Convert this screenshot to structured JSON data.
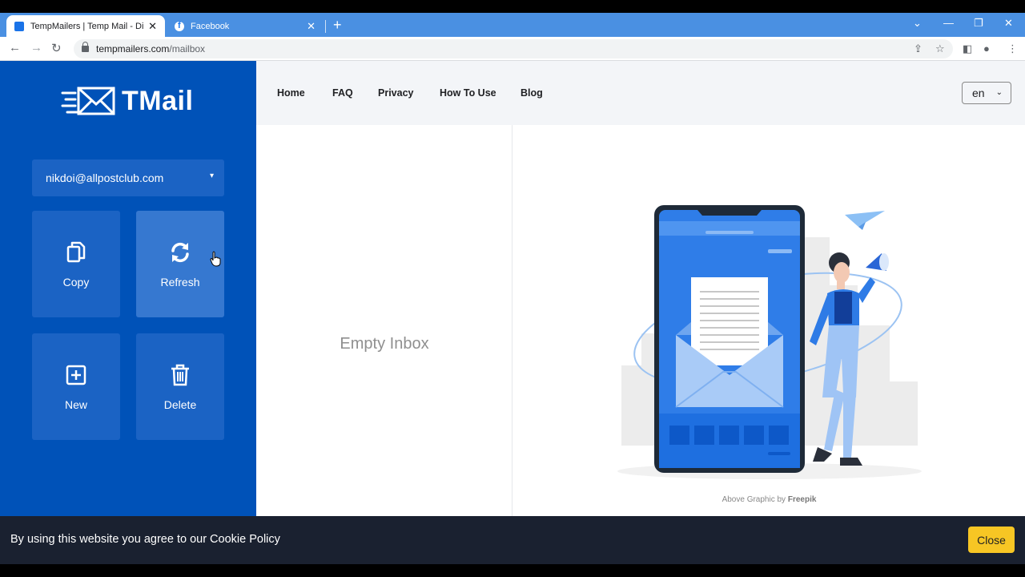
{
  "browser": {
    "tabs": [
      {
        "title": "TempMailers | Temp Mail - Dispo",
        "close": "✕"
      },
      {
        "title": "Facebook",
        "close": "✕"
      }
    ],
    "new_tab": "+",
    "window_controls": [
      "⌄",
      "—",
      "❐",
      "✕"
    ],
    "url_domain": "tempmailers.com",
    "url_path": "/mailbox"
  },
  "sidebar": {
    "logo_text": "TMail",
    "email": "nikdoi@allpostclub.com",
    "actions": [
      {
        "label": "Copy",
        "icon": "copy-icon"
      },
      {
        "label": "Refresh",
        "icon": "refresh-icon"
      },
      {
        "label": "New",
        "icon": "plus-square-icon"
      },
      {
        "label": "Delete",
        "icon": "trash-icon"
      }
    ]
  },
  "nav": {
    "links": [
      "Home",
      "FAQ",
      "Privacy",
      "How To Use",
      "Blog"
    ],
    "language": "en"
  },
  "inbox": {
    "empty_text": "Empty Inbox"
  },
  "illustration": {
    "credit_prefix": "Above Graphic by",
    "credit_name": "Freepik"
  },
  "cookie": {
    "message": "By using this website you agree to our Cookie Policy",
    "close_label": "Close"
  },
  "colors": {
    "sidebar": "#0052b8",
    "tile": "#1b63c4",
    "accent_yellow": "#f7c624",
    "tabbar": "#4a90e2"
  }
}
